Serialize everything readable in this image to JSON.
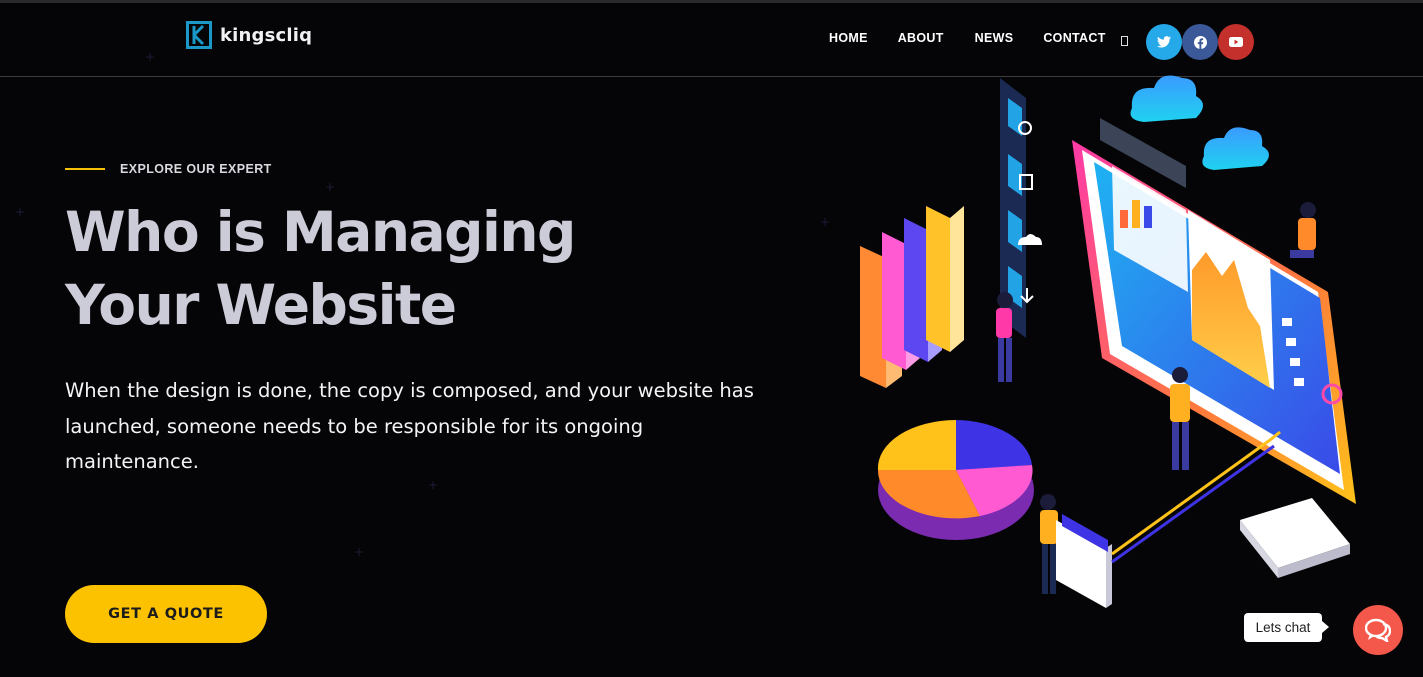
{
  "brand": {
    "name": "kingscliq",
    "color": "#1a98c7"
  },
  "nav": {
    "home": "HOME",
    "about": "ABOUT",
    "news": "NEWS",
    "contact": "CONTACT"
  },
  "header_icons": [
    "search-icon",
    "twitter-icon",
    "facebook-icon",
    "youtube-icon"
  ],
  "hero": {
    "eyebrow": "EXPLORE OUR EXPERT",
    "title_line1": "Who is Managing",
    "title_line2": "Your Website",
    "description": "When the design is done, the copy is composed, and your website has launched, someone needs to be responsible for its ongoing maintenance.",
    "cta_label": "GET A QUOTE"
  },
  "chat": {
    "label": "Lets chat",
    "icon": "chat-bubbles-icon"
  },
  "colors": {
    "accent": "#fcc200",
    "twitter": "#26a9e8",
    "facebook": "#3b5998",
    "youtube": "#c4302b",
    "chat": "#f4584b"
  }
}
